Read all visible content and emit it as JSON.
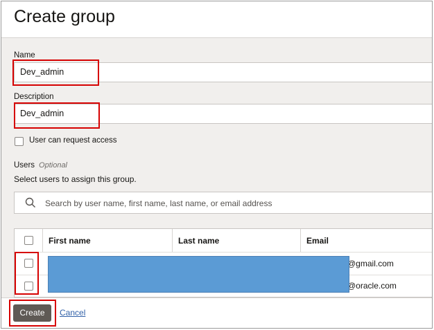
{
  "dialog": {
    "title": "Create group"
  },
  "name_field": {
    "label": "Name",
    "value": "Dev_admin"
  },
  "description_field": {
    "label": "Description",
    "value": "Dev_admin"
  },
  "request_access": {
    "label": "User can request access"
  },
  "users": {
    "label": "Users",
    "optional": "Optional",
    "helper": "Select users to assign this group.",
    "search_placeholder": "Search by user name, first name, last name, or email address"
  },
  "table": {
    "columns": [
      "First name",
      "Last name",
      "Email"
    ],
    "rows": [
      {
        "email": "@gmail.com"
      },
      {
        "email": "@oracle.com"
      }
    ]
  },
  "footer": {
    "create_label": "Create",
    "cancel_label": "Cancel"
  },
  "colors": {
    "highlight": "#d60000",
    "redaction": "#5b9bd5",
    "primary_button": "#5f5a55"
  }
}
